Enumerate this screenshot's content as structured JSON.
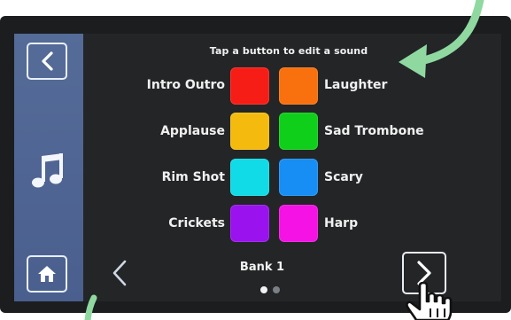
{
  "instruction": "Tap a button to edit a sound",
  "sidebar": {
    "back_icon": "chevron-left-icon",
    "music_icon": "music-note-icon",
    "home_icon": "home-icon"
  },
  "sounds": [
    {
      "label": "Intro Outro",
      "color": "#f61d16"
    },
    {
      "label": "Laughter",
      "color": "#f9700e"
    },
    {
      "label": "Applause",
      "color": "#f4bb0e"
    },
    {
      "label": "Sad Trombone",
      "color": "#10cf1a"
    },
    {
      "label": "Rim Shot",
      "color": "#10dbe6"
    },
    {
      "label": "Scary",
      "color": "#168ef4"
    },
    {
      "label": "Crickets",
      "color": "#9a12ee"
    },
    {
      "label": "Harp",
      "color": "#f412e4"
    }
  ],
  "pager": {
    "bank_label": "Bank 1",
    "pages": 2,
    "current_page": 1
  },
  "colors": {
    "sidebar": "#4f6593",
    "screen_bg": "#232527",
    "annotation_arrow": "#8fd9a0"
  }
}
